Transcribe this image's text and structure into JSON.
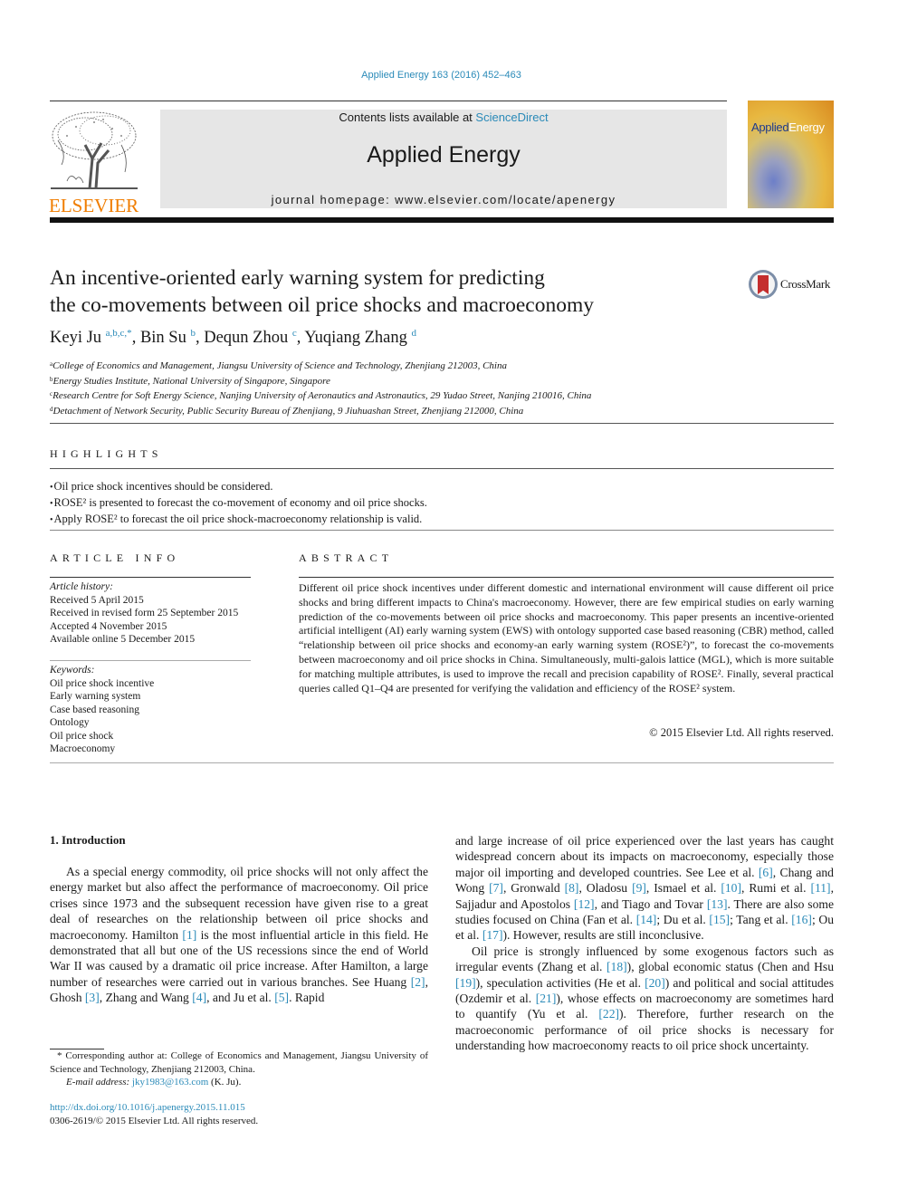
{
  "header": {
    "journal_ref": "Applied Energy 163 (2016) 452–463",
    "publisher_logo_text": "ELSEVIER",
    "contents_prefix": "Contents lists available at ",
    "contents_link": "ScienceDirect",
    "journal_title": "Applied Energy",
    "homepage": "journal homepage: www.elsevier.com/locate/apenergy",
    "cover_title_part1": "Applied",
    "cover_title_part2": "Energy",
    "colors": {
      "link": "#2a8ab8",
      "elsevier_orange": "#f07d00",
      "banner_bg": "#e6e6e6"
    }
  },
  "article": {
    "title_line1": "An incentive-oriented early warning system for predicting",
    "title_line2": "the co-movements between oil price shocks and macroeconomy",
    "crossmark_label": "CrossMark",
    "authors": [
      {
        "name": "Keyi Ju",
        "sup": "a,b,c,*"
      },
      {
        "name": "Bin Su",
        "sup": "b"
      },
      {
        "name": "Dequn Zhou",
        "sup": "c"
      },
      {
        "name": "Yuqiang Zhang",
        "sup": "d"
      }
    ],
    "affiliations": [
      {
        "key": "a",
        "text": "College of Economics and Management, Jiangsu University of Science and Technology, Zhenjiang 212003, China"
      },
      {
        "key": "b",
        "text": "Energy Studies Institute, National University of Singapore, Singapore"
      },
      {
        "key": "c",
        "text": "Research Centre for Soft Energy Science, Nanjing University of Aeronautics and Astronautics, 29 Yudao Street, Nanjing 210016, China"
      },
      {
        "key": "d",
        "text": "Detachment of Network Security, Public Security Bureau of Zhenjiang, 9 Jiuhuashan Street, Zhenjiang 212000, China"
      }
    ]
  },
  "highlights": {
    "heading": "HIGHLIGHTS",
    "items": [
      "Oil price shock incentives should be considered.",
      "ROSE² is presented to forecast the co-movement of economy and oil price shocks.",
      "Apply ROSE² to forecast the oil price shock-macroeconomy relationship is valid."
    ]
  },
  "article_info": {
    "heading": "ARTICLE INFO",
    "history_label": "Article history:",
    "history": [
      "Received 5 April 2015",
      "Received in revised form 25 September 2015",
      "Accepted 4 November 2015",
      "Available online 5 December 2015"
    ],
    "keywords_label": "Keywords:",
    "keywords": [
      "Oil price shock incentive",
      "Early warning system",
      "Case based reasoning",
      "Ontology",
      "Oil price shock",
      "Macroeconomy"
    ]
  },
  "abstract": {
    "heading": "ABSTRACT",
    "text": "Different oil price shock incentives under different domestic and international environment will cause different oil price shocks and bring different impacts to China's macroeconomy. However, there are few empirical studies on early warning prediction of the co-movements between oil price shocks and macroeconomy. This paper presents an incentive-oriented artificial intelligent (AI) early warning system (EWS) with ontology supported case based reasoning (CBR) method, called “relationship between oil price shocks and economy-an early warning system (ROSE²)”, to forecast the co-movements between macroeconomy and oil price shocks in China. Simultaneously, multi-galois lattice (MGL), which is more suitable for matching multiple attributes, is used to improve the recall and precision capability of ROSE². Finally, several practical queries called Q1–Q4 are presented for verifying the validation and efficiency of the ROSE² system.",
    "copyright": "© 2015 Elsevier Ltd. All rights reserved."
  },
  "introduction": {
    "heading": "1. Introduction",
    "left_col": {
      "p1_a": "As a special energy commodity, oil price shocks will not only affect the energy market but also affect the performance of macroeconomy. Oil price crises since 1973 and the subsequent recession have given rise to a great deal of researches on the relationship between oil price shocks and macroeconomy. Hamilton ",
      "ref1": "[1]",
      "p1_b": " is the most influential article in this field. He demonstrated that all but one of the US recessions since the end of World War II was caused by a dramatic oil price increase. After Hamilton, a large number of researches were carried out in various branches. See Huang ",
      "ref2": "[2]",
      "p1_c": ", Ghosh ",
      "ref3": "[3]",
      "p1_d": ", Zhang and Wang ",
      "ref4": "[4]",
      "p1_e": ", and Ju et al. ",
      "ref5": "[5]",
      "p1_f": ". Rapid"
    },
    "right_col": {
      "p1_a": "and large increase of oil price experienced over the last years has caught widespread concern about its impacts on macroeconomy, especially those major oil importing and developed countries. See Lee et al. ",
      "ref6": "[6]",
      "p1_b": ", Chang and Wong ",
      "ref7": "[7]",
      "p1_c": ", Gronwald ",
      "ref8": "[8]",
      "p1_d": ", Oladosu ",
      "ref9": "[9]",
      "p1_e": ", Ismael et al. ",
      "ref10": "[10]",
      "p1_f": ", Rumi et al. ",
      "ref11": "[11]",
      "p1_g": ", Sajjadur and Apostolos ",
      "ref12": "[12]",
      "p1_h": ", and Tiago and Tovar ",
      "ref13": "[13]",
      "p1_i": ". There are also some studies focused on China (Fan et al. ",
      "ref14": "[14]",
      "p1_j": "; Du et al. ",
      "ref15": "[15]",
      "p1_k": "; Tang et al. ",
      "ref16": "[16]",
      "p1_l": "; Ou et al. ",
      "ref17": "[17]",
      "p1_m": "). However, results are still inconclusive.",
      "p2_a": "Oil price is strongly influenced by some exogenous factors such as irregular events (Zhang et al. ",
      "ref18": "[18]",
      "p2_b": "), global economic status (Chen and Hsu ",
      "ref19": "[19]",
      "p2_c": "), speculation activities (He et al. ",
      "ref20": "[20]",
      "p2_d": ") and political and social attitudes (Ozdemir et al. ",
      "ref21": "[21]",
      "p2_e": "), whose effects on macroeconomy are sometimes hard to quantify (Yu et al. ",
      "ref22": "[22]",
      "p2_f": "). Therefore, further research on the macroeconomic performance of oil price shocks is necessary for understanding how macroeconomy reacts to oil price shock uncertainty."
    }
  },
  "footnote": {
    "corresponding": "* Corresponding author at: College of Economics and Management, Jiangsu University of Science and Technology, Zhenjiang 212003, China.",
    "email_label": "E-mail address:",
    "email": "jky1983@163.com",
    "email_suffix": " (K. Ju).",
    "doi": "http://dx.doi.org/10.1016/j.apenergy.2015.11.015",
    "issn": "0306-2619/© 2015 Elsevier Ltd. All rights reserved."
  }
}
